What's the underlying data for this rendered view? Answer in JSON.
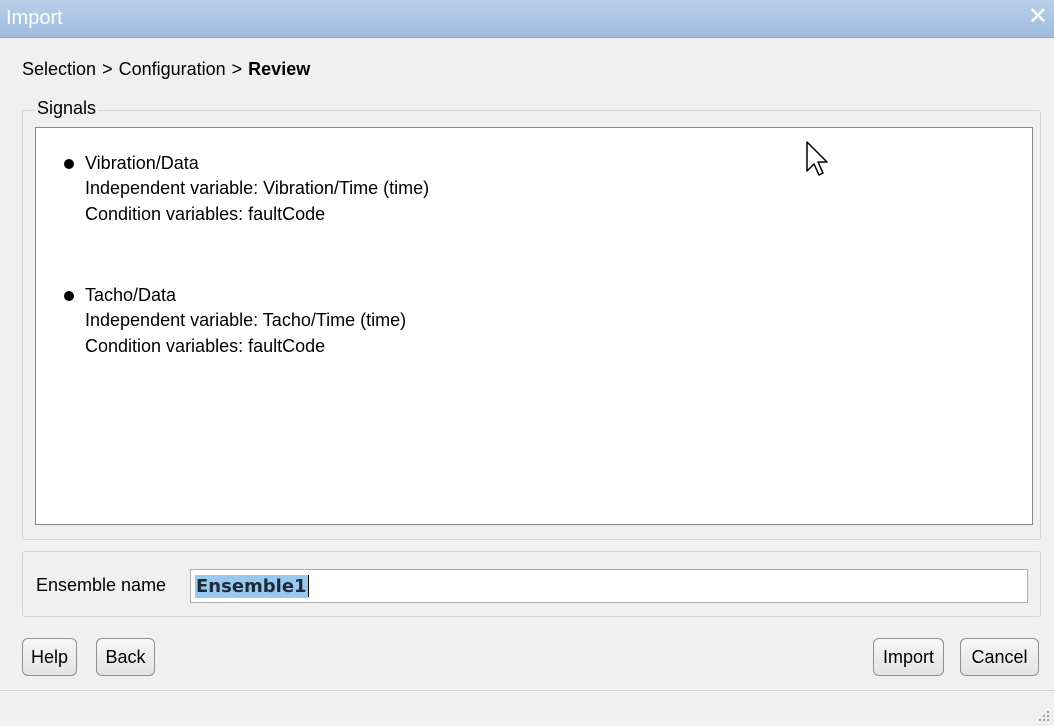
{
  "window": {
    "title": "Import",
    "close_glyph": "✕"
  },
  "breadcrumb": {
    "steps": [
      "Selection",
      "Configuration",
      "Review"
    ],
    "separator": ">"
  },
  "signals": {
    "legend": "Signals",
    "items": [
      {
        "name": "Vibration/Data",
        "independent": "Independent variable: Vibration/Time (time)",
        "condition": "Condition variables: faultCode"
      },
      {
        "name": "Tacho/Data",
        "independent": "Independent variable: Tacho/Time (time)",
        "condition": "Condition variables: faultCode"
      }
    ]
  },
  "ensemble": {
    "label": "Ensemble name",
    "value": "Ensemble1"
  },
  "buttons": {
    "help": "Help",
    "back": "Back",
    "import": "Import",
    "cancel": "Cancel"
  },
  "icons": {
    "close": "close-icon",
    "cursor": "mouse-cursor-icon",
    "grip": "resize-grip-icon"
  }
}
